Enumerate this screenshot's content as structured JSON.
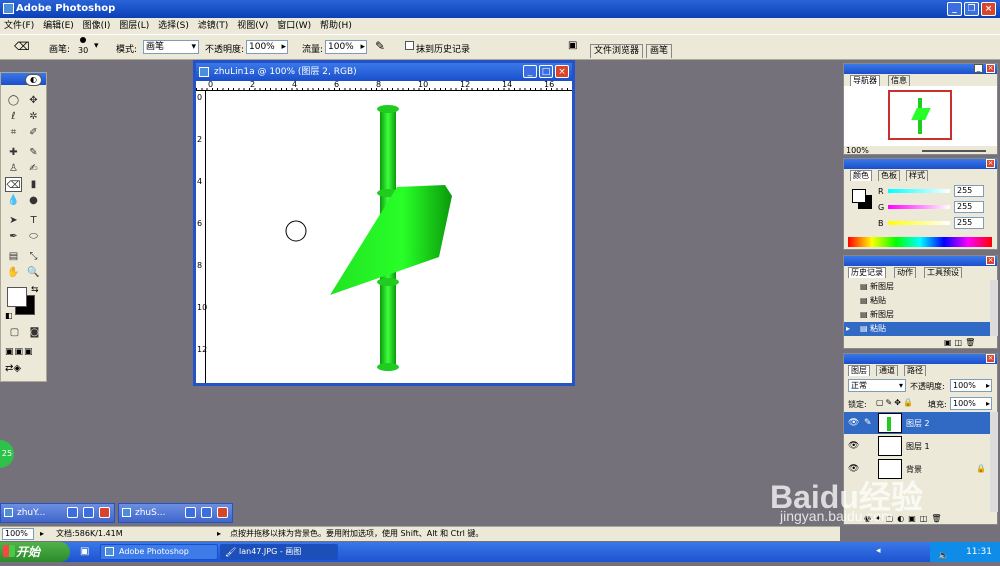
{
  "app": {
    "title": "Adobe Photoshop"
  },
  "menu": [
    "文件(F)",
    "编辑(E)",
    "图像(I)",
    "图层(L)",
    "选择(S)",
    "滤镜(T)",
    "视图(V)",
    "窗口(W)",
    "帮助(H)"
  ],
  "options": {
    "brush_label": "画笔:",
    "brush_size": "30",
    "mode_label": "模式:",
    "mode_value": "画笔",
    "opacity_label": "不透明度:",
    "opacity_value": "100%",
    "flow_label": "流量:",
    "flow_value": "100%",
    "erase_history_label": "抹到历史记录",
    "tab_file_browser": "文件浏览器",
    "tab_brushes": "画笔"
  },
  "document": {
    "title": "zhuLin1a @ 100% (图层 2, RGB)",
    "ruler_top": [
      "0",
      "2",
      "4",
      "6",
      "8",
      "10",
      "12",
      "14",
      "16"
    ],
    "ruler_left": [
      "0",
      "2",
      "4",
      "6",
      "8",
      "10",
      "12"
    ]
  },
  "navigator": {
    "tab_nav": "导航器",
    "tab_info": "信息",
    "zoom": "100%"
  },
  "color": {
    "tab_color": "颜色",
    "tab_swatches": "色板",
    "tab_styles": "样式",
    "r_label": "R",
    "g_label": "G",
    "b_label": "B",
    "r_value": "255",
    "g_value": "255",
    "b_value": "255"
  },
  "history": {
    "tab_history": "历史记录",
    "tab_actions": "动作",
    "tab_presets": "工具预设",
    "items": [
      "新图层",
      "粘贴",
      "新图层",
      "粘贴"
    ]
  },
  "layers": {
    "tab_layers": "图层",
    "tab_channels": "通道",
    "tab_paths": "路径",
    "blend_mode": "正常",
    "opacity_label": "不透明度:",
    "opacity_value": "100%",
    "lock_label": "锁定:",
    "fill_label": "填充:",
    "fill_value": "100%",
    "items": [
      "图层 2",
      "图层 1",
      "背景"
    ]
  },
  "minimized": [
    "zhuY...",
    "zhuS..."
  ],
  "status": {
    "zoom": "100%",
    "doc_size": "文档:586K/1.41M",
    "hint": "点按并拖移以抹为背景色。要用附加选项，使用 Shift、Alt 和 Ctrl 键。"
  },
  "taskbar": {
    "start": "开始",
    "task_photoshop": "Adobe Photoshop",
    "task_paint": "lan47.JPG - 画图",
    "clock": "11:31",
    "badge": "25"
  },
  "watermark": {
    "brand": "Baidu经验",
    "url": "jingyan.baidu.com"
  }
}
